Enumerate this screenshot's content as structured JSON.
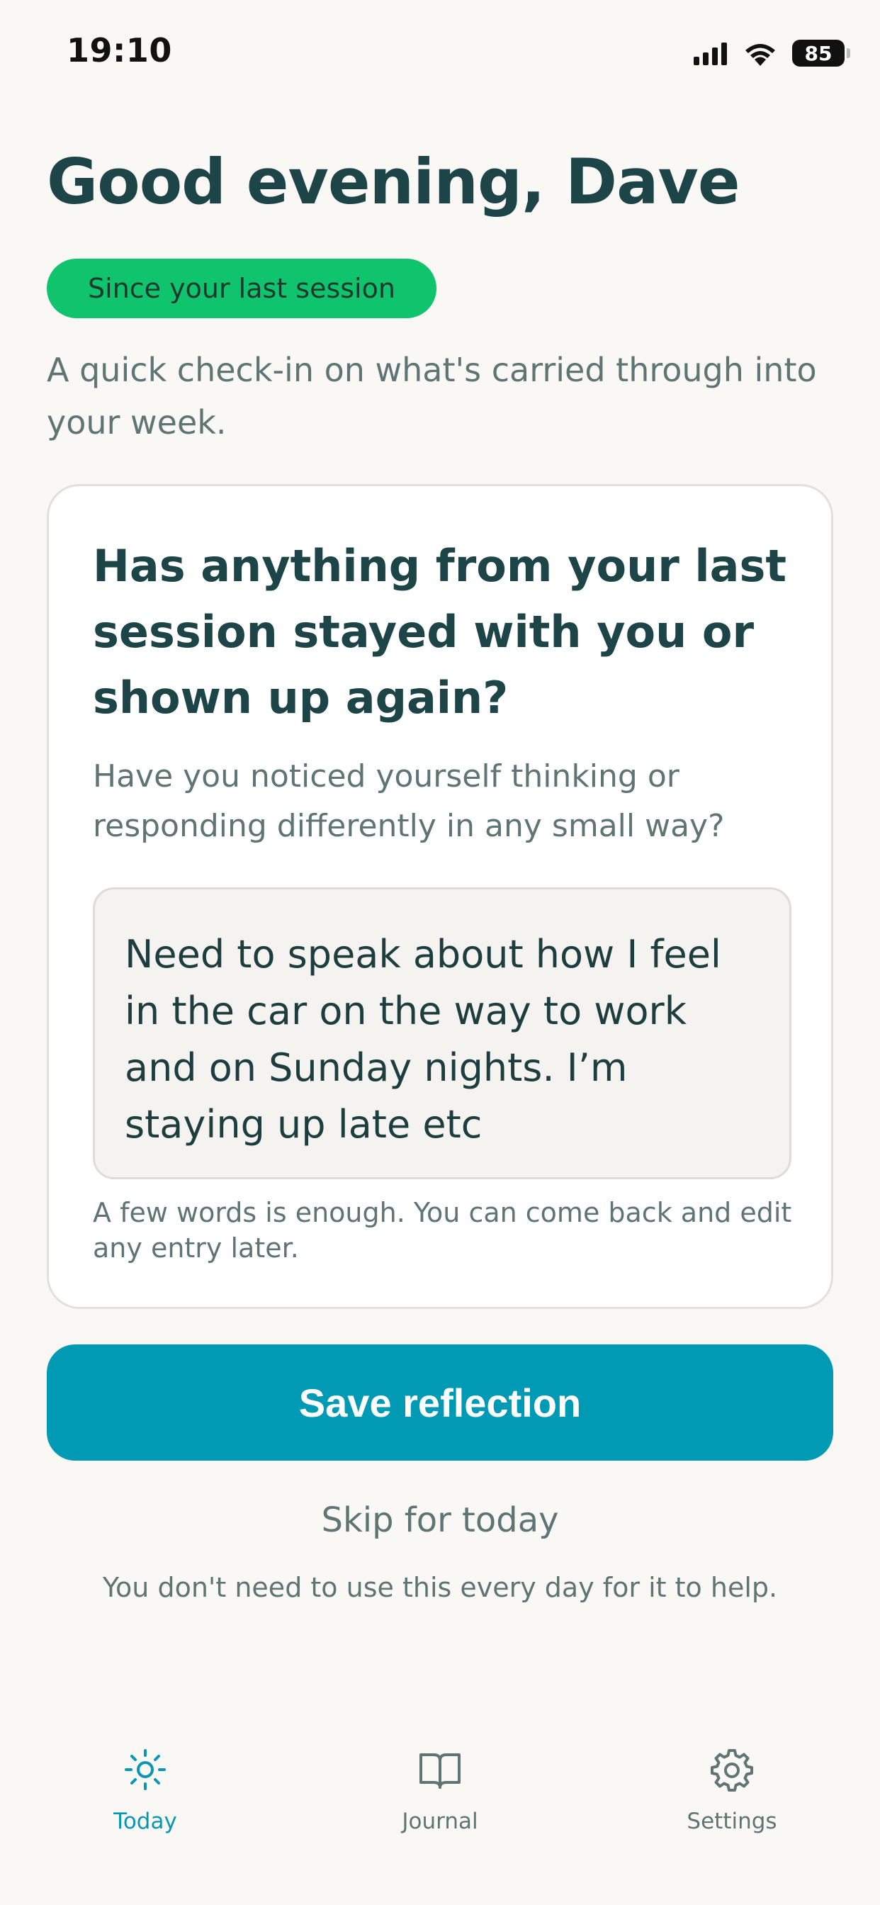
{
  "status_bar": {
    "time": "19:10",
    "battery": "85"
  },
  "header": {
    "greeting": "Good evening, Dave",
    "badge": "Since your last session",
    "intro": "A quick check-in on what's carried through into your week."
  },
  "card": {
    "question": "Has anything from your last session stayed with you or shown up again?",
    "prompt": "Have you noticed yourself thinking or responding differently in any small way?",
    "answer": "Need to speak about how I feel in the car on the way to work and on Sunday nights. I’m staying up late etc",
    "helper": "A few words is enough. You can come back and edit any entry later."
  },
  "actions": {
    "save_label": "Save reflection",
    "skip_label": "Skip for today",
    "reassurance": "You don't need to use this every day for it to help."
  },
  "tabs": [
    {
      "label": "Today",
      "icon": "sun-icon",
      "active": true
    },
    {
      "label": "Journal",
      "icon": "book-icon",
      "active": false
    },
    {
      "label": "Settings",
      "icon": "gear-icon",
      "active": false
    }
  ],
  "colors": {
    "accent": "#009ab5",
    "badge": "#10c46e",
    "heading": "#1d4447",
    "muted": "#5e7574",
    "background": "#faf8f4"
  }
}
